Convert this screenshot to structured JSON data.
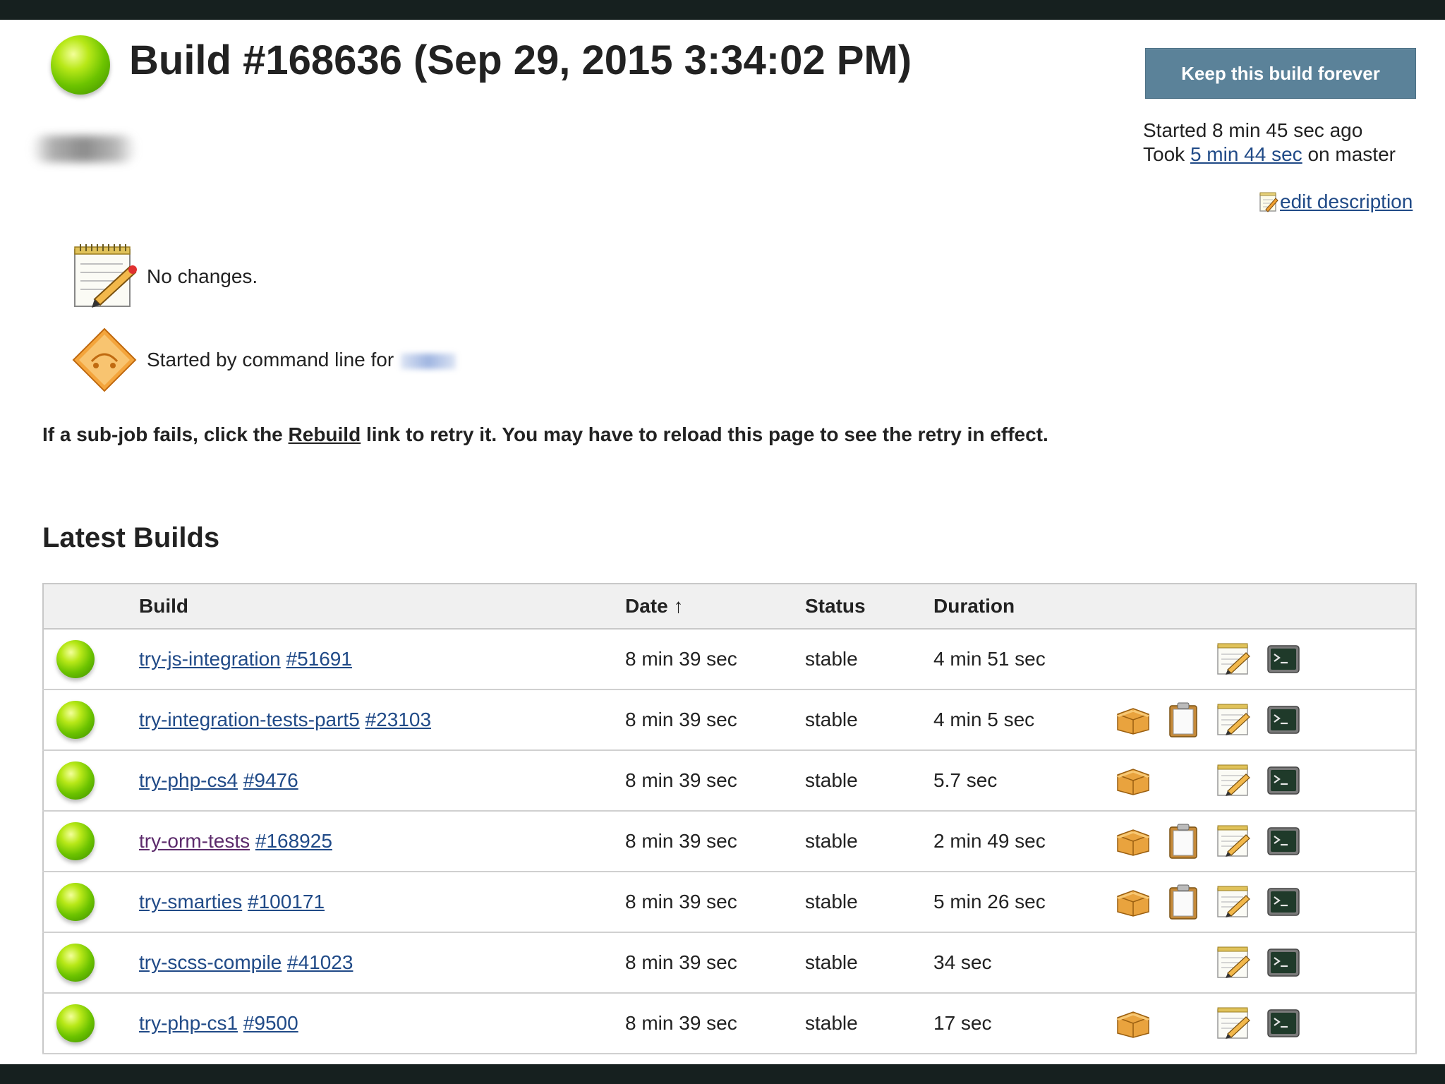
{
  "header": {
    "title": "Build #168636 (Sep 29, 2015 3:34:02 PM)",
    "keep_button": "Keep this build forever",
    "started_text": "Started 8 min 45 sec ago",
    "took_prefix": "Took ",
    "took_link": "5 min 44 sec",
    "took_suffix": " on master",
    "edit_description": "edit description"
  },
  "changes": {
    "no_changes": "No changes.",
    "started_by": "Started by command line for "
  },
  "info": {
    "prefix": "If a sub-job fails, click the ",
    "rebuild_link": "Rebuild",
    "suffix": " link to retry it. You may have to reload this page to see the retry in effect."
  },
  "latest_builds": {
    "title": "Latest Builds",
    "columns": {
      "build": "Build",
      "date": "Date",
      "date_sort": "↑",
      "status": "Status",
      "duration": "Duration"
    },
    "rows": [
      {
        "job": "try-js-integration",
        "number": "#51691",
        "date": "8 min 39 sec",
        "status": "stable",
        "duration": "4 min 51 sec",
        "icons": [
          "",
          "",
          "notepad-icon",
          "console-icon"
        ]
      },
      {
        "job": "try-integration-tests-part5",
        "number": "#23103",
        "date": "8 min 39 sec",
        "status": "stable",
        "duration": "4 min 5 sec",
        "icons": [
          "package-icon",
          "clipboard-icon",
          "notepad-icon",
          "console-icon"
        ]
      },
      {
        "job": "try-php-cs4",
        "number": "#9476",
        "date": "8 min 39 sec",
        "status": "stable",
        "duration": "5.7 sec",
        "icons": [
          "package-icon",
          "",
          "notepad-icon",
          "console-icon"
        ]
      },
      {
        "job": "try-orm-tests",
        "number": "#168925",
        "date": "8 min 39 sec",
        "status": "stable",
        "duration": "2 min 49 sec",
        "icons": [
          "package-icon",
          "clipboard-icon",
          "notepad-icon",
          "console-icon"
        ]
      },
      {
        "job": "try-smarties",
        "number": "#100171",
        "date": "8 min 39 sec",
        "status": "stable",
        "duration": "5 min 26 sec",
        "icons": [
          "package-icon",
          "clipboard-icon",
          "notepad-icon",
          "console-icon"
        ]
      },
      {
        "job": "try-scss-compile",
        "number": "#41023",
        "date": "8 min 39 sec",
        "status": "stable",
        "duration": "34 sec",
        "icons": [
          "",
          "",
          "notepad-icon",
          "console-icon"
        ]
      },
      {
        "job": "try-php-cs1",
        "number": "#9500",
        "date": "8 min 39 sec",
        "status": "stable",
        "duration": "17 sec",
        "icons": [
          "package-icon",
          "",
          "notepad-icon",
          "console-icon"
        ]
      }
    ]
  },
  "colors": {
    "link": "#204a87",
    "visited_link": "#5c2a6b",
    "keep_button": "#5b8299",
    "header_bar": "#16201f"
  }
}
